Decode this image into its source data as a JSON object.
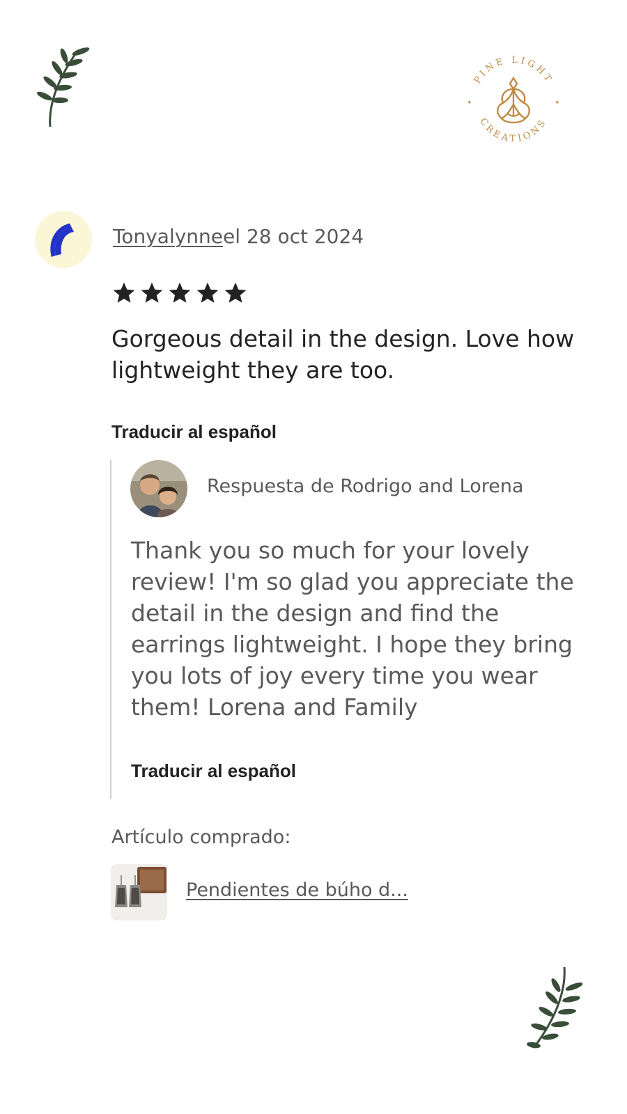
{
  "decor": {
    "leaf_color": "#3a4d39",
    "logo_color": "#c08a45"
  },
  "logo": {
    "text_top": "PINE LIGHT",
    "text_bottom": "CREATIONS"
  },
  "review": {
    "reviewer_name": "Tonyalynne",
    "date_text": "el 28 oct 2024",
    "rating": 5,
    "rating_max": 5,
    "text": "Gorgeous detail in the design. Love how lightweight they are too.",
    "translate_label": "Traducir al español",
    "avatar_icon": "moon-icon",
    "avatar_bg": "#fbf6d6",
    "avatar_fg": "#2233c8"
  },
  "reply": {
    "header": "Respuesta de Rodrigo and Lorena",
    "text": "Thank you so much for your lovely review! I'm so glad you appreciate the detail in the design and find the earrings lightweight. I hope they bring you lots of joy every time you wear them! Lorena and Family",
    "translate_label": "Traducir al español"
  },
  "purchased": {
    "label": "Artículo comprado:",
    "item_title": "Pendientes de búho d..."
  }
}
